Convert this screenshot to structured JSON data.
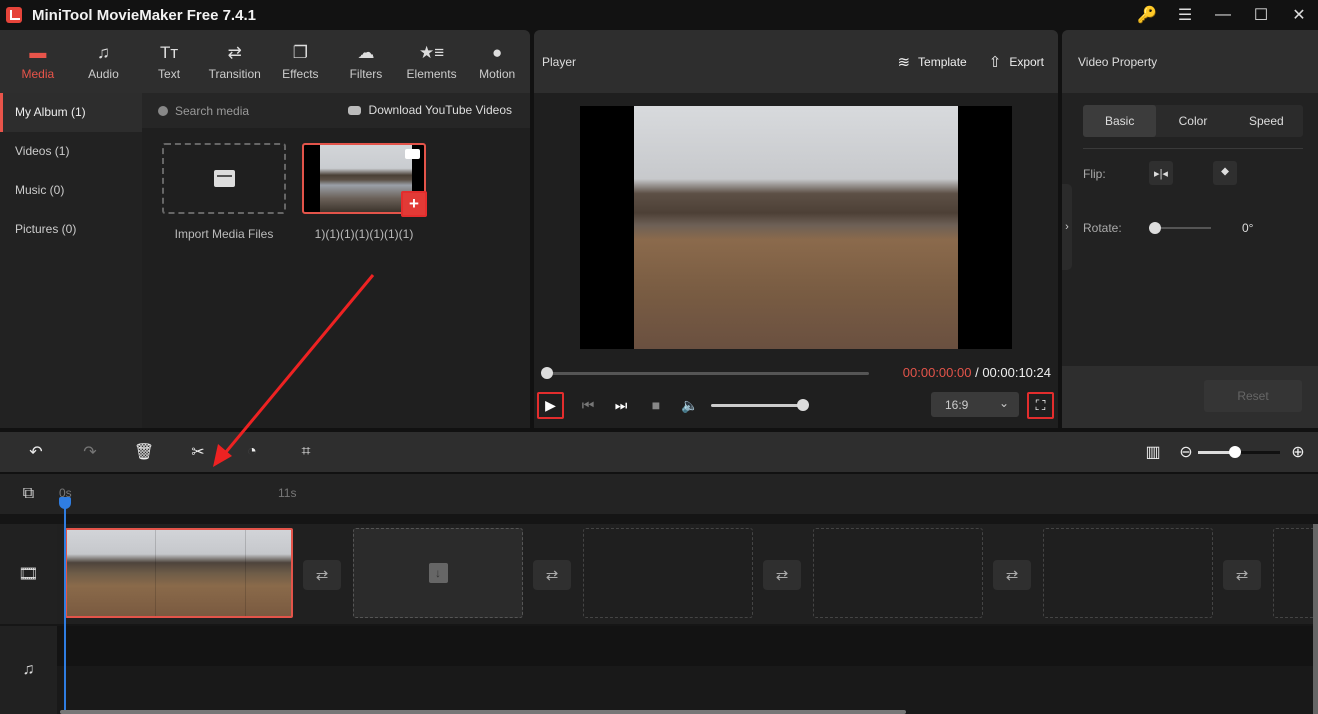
{
  "titlebar": {
    "title": "MiniTool MovieMaker Free 7.4.1",
    "icons": [
      "key-icon",
      "menu-icon",
      "minimize-icon",
      "maximize-icon",
      "close-icon"
    ]
  },
  "toolbar_tabs": [
    {
      "label": "Media",
      "icon": "folder-icon",
      "active": true
    },
    {
      "label": "Audio",
      "icon": "music-icon"
    },
    {
      "label": "Text",
      "icon": "text-icon"
    },
    {
      "label": "Transition",
      "icon": "transition-icon"
    },
    {
      "label": "Effects",
      "icon": "effects-icon"
    },
    {
      "label": "Filters",
      "icon": "filters-icon"
    },
    {
      "label": "Elements",
      "icon": "elements-icon"
    },
    {
      "label": "Motion",
      "icon": "motion-icon"
    }
  ],
  "album": {
    "items": [
      {
        "label": "My Album (1)",
        "active": true
      },
      {
        "label": "Videos (1)"
      },
      {
        "label": "Music (0)"
      },
      {
        "label": "Pictures (0)"
      }
    ]
  },
  "media": {
    "search_placeholder": "Search media",
    "download_label": "Download YouTube Videos",
    "import_label": "Import Media Files",
    "items": [
      {
        "name": "1)(1)(1)(1)(1)(1)(1)",
        "type": "video"
      }
    ]
  },
  "player": {
    "title": "Player",
    "template_label": "Template",
    "export_label": "Export",
    "current_time": "00:00:00:00",
    "separator": " / ",
    "total_time": "00:00:10:24",
    "progress": 0,
    "volume": 1.0,
    "aspect_ratio": "16:9"
  },
  "property": {
    "title": "Video Property",
    "tabs": [
      {
        "label": "Basic",
        "active": true
      },
      {
        "label": "Color"
      },
      {
        "label": "Speed"
      }
    ],
    "flip_label": "Flip:",
    "rotate_label": "Rotate:",
    "rotate_value": "0°",
    "reset_label": "Reset"
  },
  "timeline_toolbar": {
    "buttons": [
      "undo-icon",
      "redo-icon",
      "delete-icon",
      "split-icon",
      "speed-icon",
      "crop-icon"
    ],
    "zoom_level": 0.45
  },
  "timeline": {
    "ruler_labels": [
      "0s",
      "11s"
    ],
    "clip_count": 1,
    "empty_slots": 5,
    "transition_slots": 5
  },
  "glyphs": {
    "key": "🔑",
    "menu": "☰",
    "minimize": "—",
    "maximize": "☐",
    "close": "✕",
    "music": "♫",
    "text": "Tт",
    "transition": "⇄",
    "effects": "❐",
    "filters": "☁",
    "elements": "★≡",
    "motion": "●",
    "layers": "≋",
    "export": "⇧",
    "play": "▶",
    "prev": "⏮",
    "next": "⏭",
    "stop": "■",
    "volume": "🔈",
    "chevron_down": "⌄",
    "fullscreen": "⛶",
    "flip_h": "▸|◂",
    "flip_v": "⯁",
    "chevron_right": "›",
    "undo": "↶",
    "redo": "↷",
    "delete": "🗑",
    "split": "✂",
    "speed": "◔",
    "crop": "⌗",
    "fit": "▥",
    "zoom_out": "⊖",
    "zoom_in": "⊕",
    "add_track": "⧉",
    "film": "🎞",
    "swap": "⇄",
    "plus": "+",
    "import_slot": "↓"
  }
}
